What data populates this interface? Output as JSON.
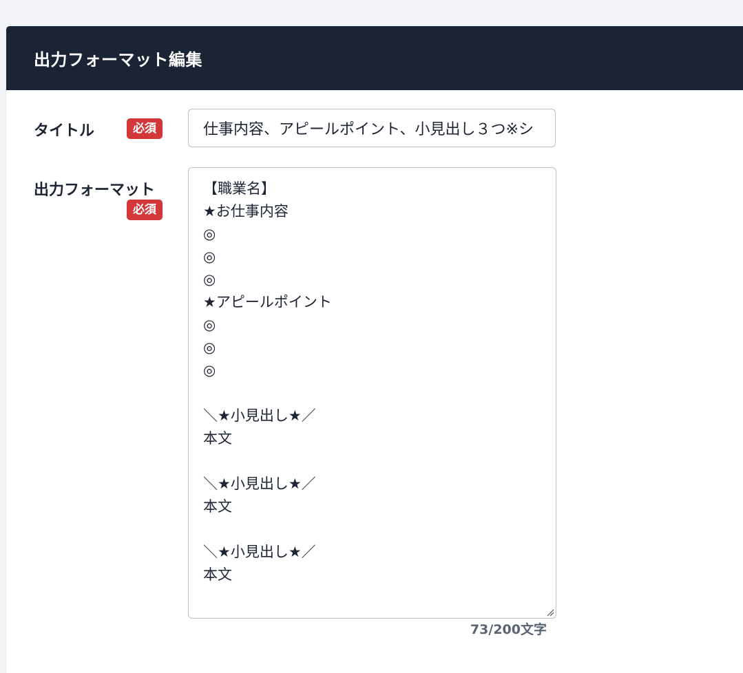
{
  "header": {
    "title": "出力フォーマット編集"
  },
  "form": {
    "title_field": {
      "label": "タイトル",
      "required_badge": "必須",
      "value": "仕事内容、アピールポイント、小見出し３つ※シ"
    },
    "format_field": {
      "label": "出力フォーマット",
      "required_badge": "必須",
      "value": "【職業名】\n★お仕事内容\n◎\n◎\n◎\n★アピールポイント\n◎\n◎\n◎\n\n＼★小見出し★／\n本文\n\n＼★小見出し★／\n本文\n\n＼★小見出し★／\n本文",
      "char_count": "73/200文字"
    }
  },
  "icons": {
    "resize": "resize-grip-icon"
  },
  "colors": {
    "header_bg": "#1b2434",
    "required_badge": "#d3373a",
    "page_bg": "#f4f5f9"
  }
}
